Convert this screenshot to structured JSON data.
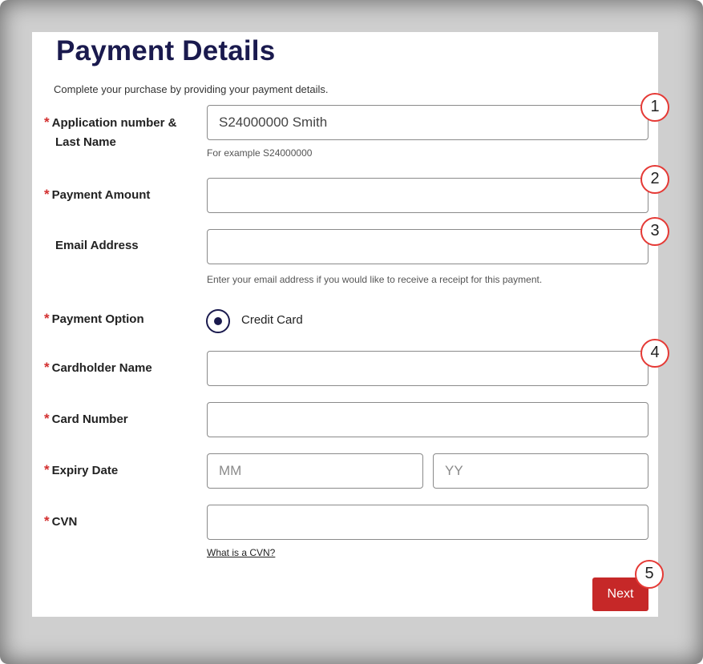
{
  "page": {
    "title": "Payment Details",
    "intro": "Complete your purchase by providing your payment details."
  },
  "colors": {
    "title": "#1a1a4e",
    "required_star": "#d32f2f",
    "next_button": "#c62828",
    "annotation": "#e53935"
  },
  "form": {
    "required_mark": "*",
    "application": {
      "label_line1": "Application number &",
      "label_line2": "Last Name",
      "value": "S24000000 Smith",
      "hint": "For example S24000000"
    },
    "payment_amount": {
      "label": "Payment Amount",
      "value": ""
    },
    "email": {
      "label": "Email Address",
      "value": "",
      "hint": "Enter your email address if you would like to receive a receipt for this payment."
    },
    "payment_option": {
      "label": "Payment Option",
      "selected": "Credit Card"
    },
    "cardholder_name": {
      "label": "Cardholder Name",
      "value": ""
    },
    "card_number": {
      "label": "Card Number",
      "value": ""
    },
    "expiry": {
      "label": "Expiry Date",
      "month_placeholder": "MM",
      "year_placeholder": "YY"
    },
    "cvn": {
      "label": "CVN",
      "value": "",
      "help_link": "What is a CVN?"
    },
    "next_label": "Next"
  },
  "annotations": [
    "1",
    "2",
    "3",
    "4",
    "5"
  ]
}
